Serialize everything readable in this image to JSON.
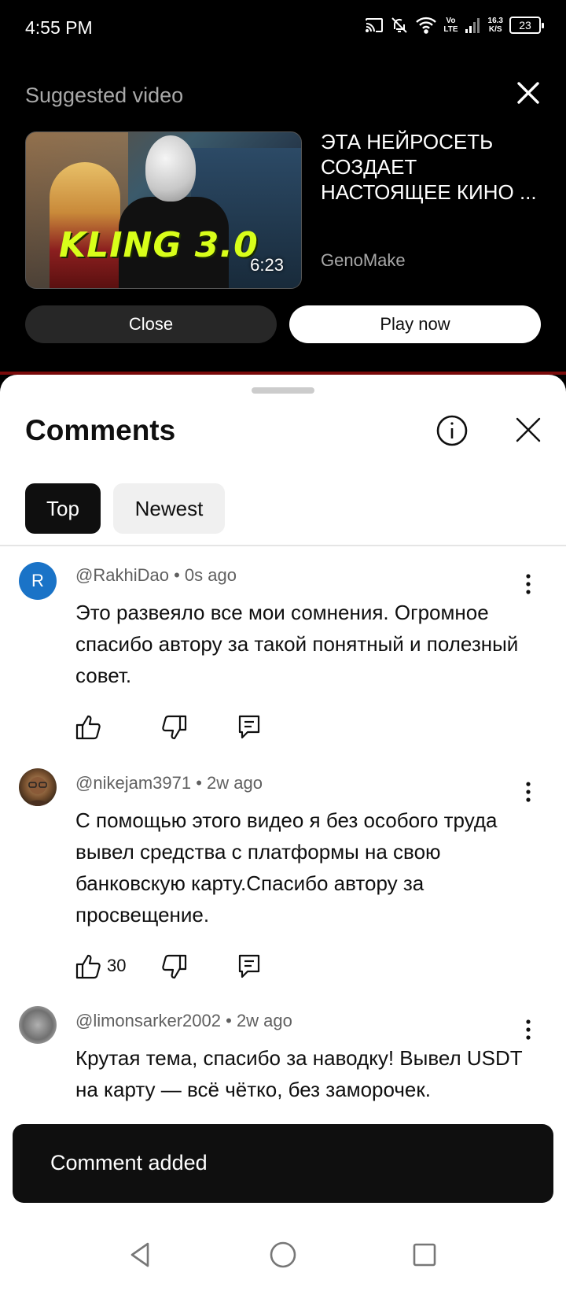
{
  "status_bar": {
    "time": "4:55 PM",
    "net_speed_top": "16.3",
    "net_speed_bottom": "K/S",
    "volte_top": "Vo",
    "volte_bottom": "LTE",
    "battery": "23",
    "icons": [
      "cast-icon",
      "bell-off-icon",
      "wifi-icon",
      "volte-icon",
      "signal-icon",
      "battery-icon"
    ]
  },
  "suggested": {
    "header": "Suggested video",
    "thumbnail_text": "KLING 3.0",
    "duration": "6:23",
    "title": "ЭТА НЕЙРОСЕТЬ СОЗДАЕТ НАСТОЯЩЕЕ КИНО ...",
    "channel": "GenoMake",
    "close_label": "Close",
    "play_label": "Play now"
  },
  "comments_panel": {
    "title": "Comments",
    "filters": [
      {
        "label": "Top",
        "selected": true
      },
      {
        "label": "Newest",
        "selected": false
      }
    ],
    "comments": [
      {
        "author": "@RakhiDao",
        "time": "0s ago",
        "avatar_letter": "R",
        "text": "Это развеяло все мои сомнения. Огромное спасибо автору за такой понятный и полезный совет.",
        "likes": ""
      },
      {
        "author": "@nikejam3971",
        "time": "2w ago",
        "avatar_letter": "",
        "text": "С помощью этого видео я без особого труда вывел средства с платформы на свою банковскую карту.Спасибо автору за просвещение.",
        "likes": "30"
      },
      {
        "author": "@limonsarker2002",
        "time": "2w ago",
        "avatar_letter": "",
        "text": "Крутая тема, спасибо за наводку! Вывел USDT на карту — всё чётко, без заморочек.",
        "likes": ""
      }
    ]
  },
  "toast": {
    "message": "Comment added"
  },
  "colors": {
    "accent_red": "#7a0a0a",
    "avatar_blue": "#1a73c7",
    "text_primary": "#0f0f0f",
    "text_secondary": "#606060"
  }
}
